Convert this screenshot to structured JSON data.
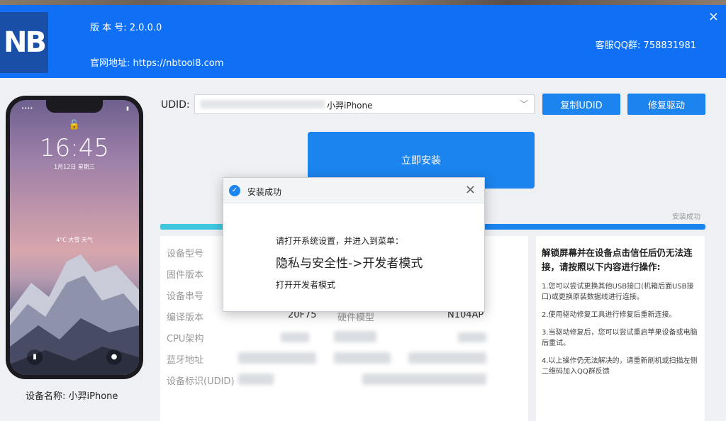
{
  "header": {
    "logo_text": "NB",
    "version": "版 本 号:  2.0.0.0",
    "site": "官网地址:  https://nbtool8.com",
    "qq": "客服QQ群:  758831981",
    "close": "×"
  },
  "phone": {
    "status_left": "••••",
    "status_right": "▮",
    "lock": "🔓",
    "time": "16:45",
    "date": "1月12日 星期三",
    "widget": "4°C  大雪  天气",
    "flash_icon": "▮",
    "camera_icon": "●",
    "device_name": "设备名称: 小羿iPhone"
  },
  "udid": {
    "label": "UDID:",
    "selected": "小羿iPhone",
    "caret": "﹀",
    "copy_button": "复制UDID",
    "repair_button": "修复驱动"
  },
  "install_button": "立即安装",
  "progress": {
    "label": "安装成功",
    "percent": 100
  },
  "info": {
    "rows": [
      {
        "label": "设备型号"
      },
      {
        "label": "固件版本"
      },
      {
        "label": "设备串号"
      },
      {
        "label": "编译版本",
        "value": "20F75",
        "mid_label": "硬件模型",
        "mid_value": "N104AP"
      },
      {
        "label": "CPU架构"
      },
      {
        "label": "蓝牙地址"
      },
      {
        "label": "设备标识(UDID)"
      }
    ]
  },
  "help": {
    "title": "解锁屏幕并在设备点击信任后仍无法连接，请按照以下内容进行操作:",
    "items": [
      "1.您可以尝试更换其他USB接口(机箱后面USB接口)或更换原装数据线进行连接。",
      "2.使用驱动修复工具进行修复后重新连接。",
      "3.当驱动修复后，您可以尝试重启苹果设备或电脑后重试。",
      "4.以上操作仍无法解决的，请重新刷机或扫描左侧二维码加入QQ群反馈"
    ]
  },
  "dialog": {
    "icon": "✓",
    "title": "安装成功",
    "close": "×",
    "line1": "请打开系统设置，并进入到菜单：",
    "line2": "隐私与安全性->开发者模式",
    "line3": "打开开发者模式"
  },
  "colors": {
    "brand": "#0f6ff5",
    "button": "#1b84ee",
    "progress_start": "#3fc7e0"
  }
}
